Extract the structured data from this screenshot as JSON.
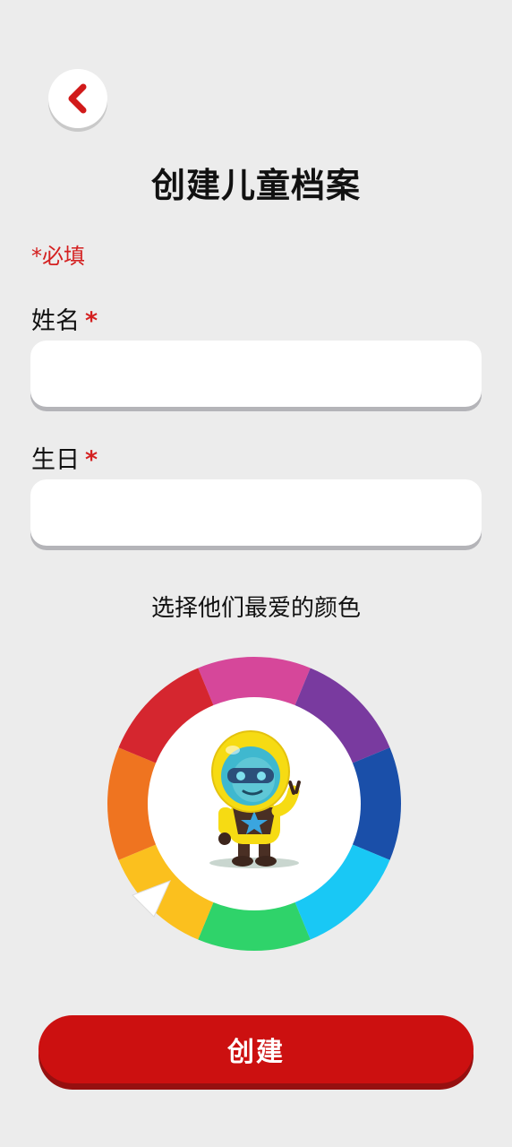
{
  "header": {
    "back_icon": "chevron-left-icon",
    "title": "创建儿童档案"
  },
  "form": {
    "required_note": "*必填",
    "name": {
      "label": "姓名",
      "required_mark": "*",
      "value": "",
      "placeholder": ""
    },
    "birthday": {
      "label": "生日",
      "required_mark": "*",
      "value": "",
      "placeholder": ""
    }
  },
  "color_picker": {
    "prompt": "选择他们最爱的颜色",
    "colors": [
      "#d6479a",
      "#793a9f",
      "#1a4fa9",
      "#19c8f5",
      "#2fd36a",
      "#fbc01e",
      "#ef7420",
      "#d5262f"
    ],
    "selected_color": "#fbc01e",
    "center_image": "yellow-astronaut-character"
  },
  "actions": {
    "create_label": "创建",
    "accent_color": "#cc1010"
  }
}
